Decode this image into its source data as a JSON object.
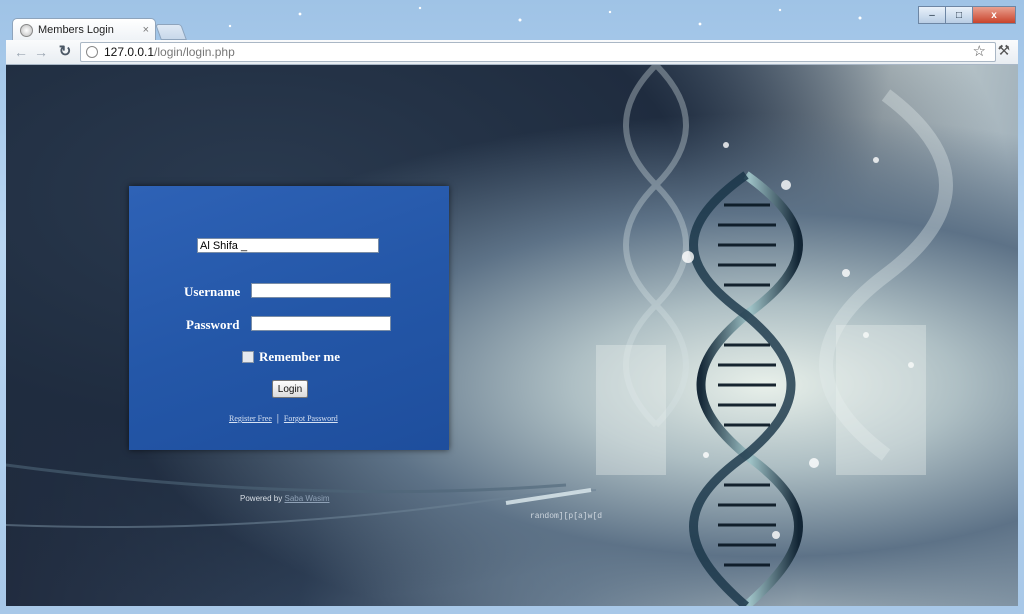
{
  "browser": {
    "tab_title": "Members Login",
    "tab_close": "×",
    "url_host": "127.0.0.1",
    "url_path": "/login/login.php",
    "window_controls": {
      "minimize": "–",
      "maximize": "□",
      "close": "x"
    },
    "nav": {
      "back": "←",
      "forward": "→",
      "reload": "↻",
      "star": "☆",
      "wrench": "⚒"
    }
  },
  "login": {
    "org_value": "Al Shifa _",
    "username_label": "Username",
    "password_label": "Password",
    "remember_label": "Remember me",
    "login_button": "Login",
    "register_link": "Register Free",
    "separator": "|",
    "forgot_link": "Forgot Password"
  },
  "footer": {
    "powered_by": "Powered by",
    "author": "Saba Wasim",
    "brand": "random][p[a]w[d"
  },
  "colors": {
    "login_box": "#2457a8",
    "page_dark": "#1d2638",
    "dna_accent": "#cfe3e3"
  }
}
